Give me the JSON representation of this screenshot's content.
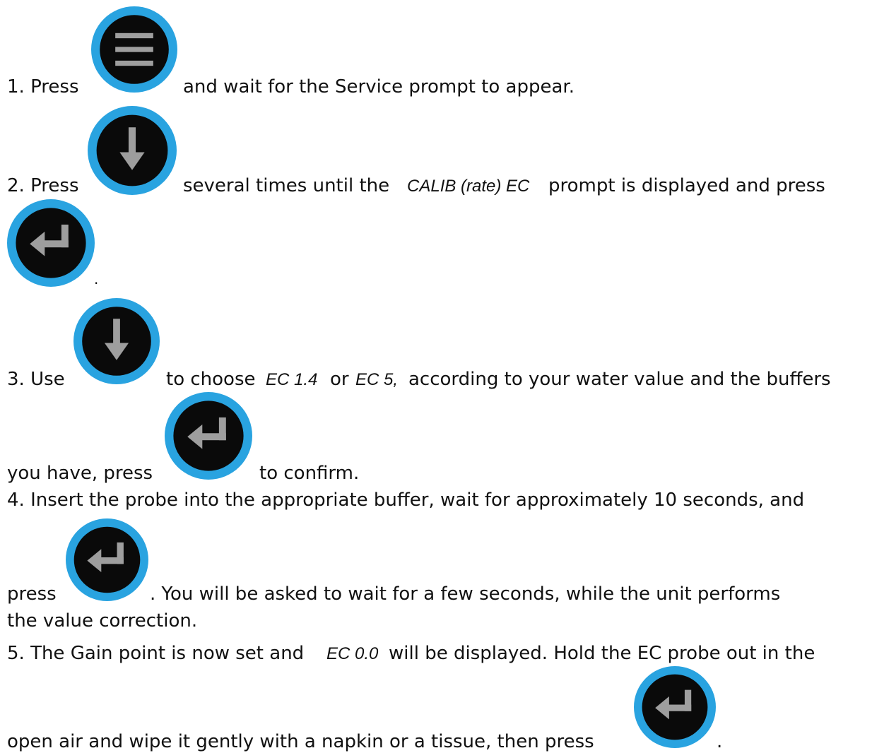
{
  "colors": {
    "button_ring": "#29a3e0",
    "button_face": "#0a0a0a",
    "glyph": "#9e9e9e"
  },
  "icons": {
    "menu": "menu-icon",
    "down": "arrow-down-icon",
    "enter": "enter-icon"
  },
  "steps": [
    {
      "prefix": "1. Press",
      "text": "and wait for the Service prompt to appear."
    },
    {
      "prefix": "2. Press",
      "text_a": "several times until the",
      "term": "CALIB (rate) EC",
      "text_b": "prompt is displayed and press",
      "end": "."
    },
    {
      "prefix": "3. Use",
      "text_a": "to choose",
      "term_a": "EC 1.4",
      "or": "or",
      "term_b": "EC 5,",
      "text_b": "according to your water value and the buffers",
      "line2": "you have, press",
      "end": "to confirm."
    },
    {
      "line1": "4. Insert the probe into the appropriate buffer, wait for approximately 10 seconds, and",
      "prefix": "press",
      "text": ". You will be asked to wait for a few seconds, while the unit performs",
      "line3": "the value correction."
    },
    {
      "text_a": "5. The Gain point is now set and",
      "term": "EC 0.0",
      "text_b": "will be displayed. Hold the EC probe out in the",
      "line2": "open air and wipe it gently with a napkin or a tissue, then press",
      "end": "."
    }
  ]
}
